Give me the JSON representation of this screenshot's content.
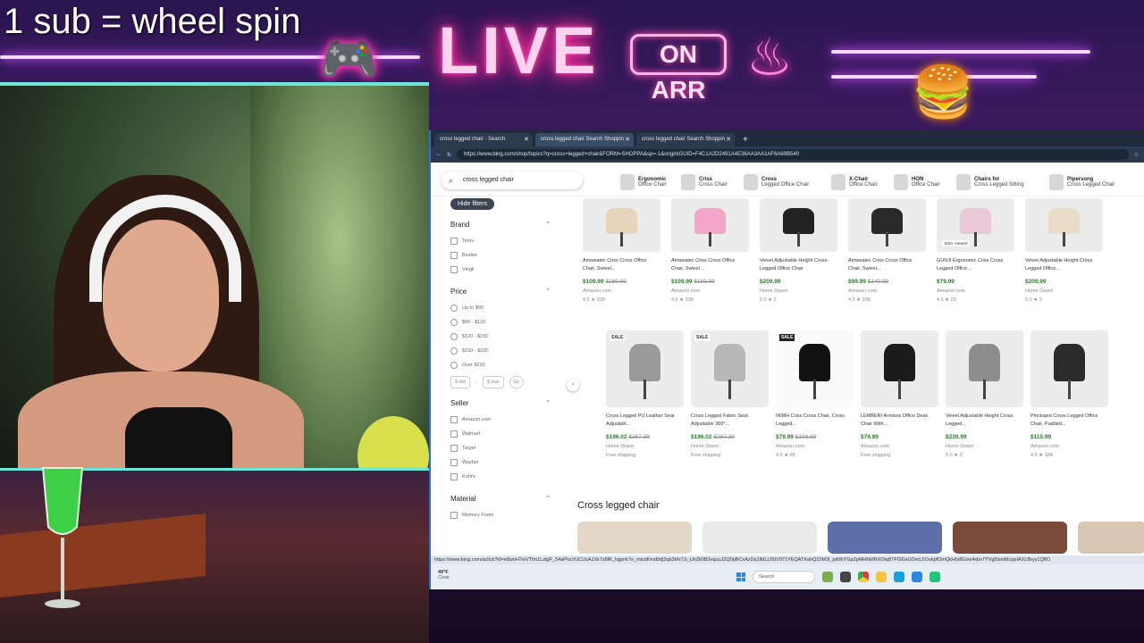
{
  "overlay": {
    "sub_text": "1 sub = wheel spin",
    "live_text": "LIVE",
    "onair_text": "ON ARR"
  },
  "browser": {
    "tabs": [
      {
        "label": "cross legged chair - Search",
        "active": false
      },
      {
        "label": "cross legged chair Search Shoppin",
        "active": true
      },
      {
        "label": "cross legged chair Search Shoppin",
        "active": false
      }
    ],
    "url": "https://www.bing.com/shop/topics?q=cross+legged+chair&FORM=SHOPPA&sp=-1&originIGUID=F4C1A2D2491A4E36AA3AA1AF6A69B540",
    "search_value": "cross legged chair",
    "chips": [
      {
        "top": "Ergonomic",
        "bottom": "Office Chair"
      },
      {
        "top": "Criss",
        "bottom": "Cross Chair"
      },
      {
        "top": "Cross",
        "bottom": "Legged Office Chair"
      },
      {
        "top": "X-Chair",
        "bottom": "Office Chair"
      },
      {
        "top": "HON",
        "bottom": "Office Chair"
      },
      {
        "top": "Chairs for",
        "bottom": "Cross Legged Sitting"
      },
      {
        "top": "Pipersong",
        "bottom": "Cross Legged Chair"
      }
    ],
    "hide_filters": "Hide filters",
    "filters": {
      "brand": {
        "title": "Brand",
        "options": [
          "Temu",
          "Bestier",
          "Vingli"
        ]
      },
      "price": {
        "title": "Price",
        "options": [
          "Up to $90",
          "$90 - $120",
          "$120 - $150",
          "$150 - $220",
          "Over $220"
        ],
        "min": "$ min",
        "max": "$ max",
        "go": "Go"
      },
      "seller": {
        "title": "Seller",
        "options": [
          "Amazon.com",
          "Walmart",
          "Target",
          "Wayfair",
          "Kohl's"
        ]
      },
      "material": {
        "title": "Material",
        "options": [
          "Memory Foam"
        ]
      }
    },
    "row1": [
      {
        "title": "Amweatec Criss Cross Office Chair, Swivel...",
        "price": "$109.99",
        "old": "$169.99",
        "store": "Amazon.com",
        "rating": "4.5 ★ 338"
      },
      {
        "title": "Amweatec Criss Cross Office Chair, Swivel...",
        "price": "$109.99",
        "old": "$169.99",
        "store": "Amazon.com",
        "rating": "4.5 ★ 338"
      },
      {
        "title": "Velvet Adjustable Height Cross-Legged Office Chair",
        "price": "$209.99",
        "old": "",
        "store": "Home Depot",
        "rating": "5.0 ★ 2"
      },
      {
        "title": "Amweatec Criss Cross Office Chair, Swivel...",
        "price": "$99.99",
        "old": "$149.99",
        "store": "Amazon.com",
        "rating": "4.5 ★ 338"
      },
      {
        "title": "GUNJI Ergonomic Criss Cross Legged Office...",
        "price": "$79.99",
        "old": "",
        "store": "Amazon.com",
        "rating": "4.5 ★ 25",
        "badge": "500+ viewed"
      },
      {
        "title": "Velvet Adjustable Height Cross Legged Office...",
        "price": "$209.99",
        "old": "",
        "store": "Home Depot",
        "rating": "5.0 ★ 3"
      }
    ],
    "row2": [
      {
        "title": "Cross Legged PU Leather Seat Adjustabl...",
        "price": "$196.02",
        "old": "$287.39",
        "store": "Home Depot",
        "ship": "Free shipping",
        "sale": "SALE"
      },
      {
        "title": "Cross Legged Fabric Seat Adjustable 360°...",
        "price": "$196.02",
        "old": "$287.39",
        "store": "Home Depot",
        "ship": "Free shipping",
        "sale": "SALE"
      },
      {
        "title": "IWMH Criss Cross Chair, Cross Legged...",
        "price": "$79.99",
        "old": "$109.99",
        "store": "Amazon.com",
        "ship": "4.5 ★ 85",
        "sale": "SALE"
      },
      {
        "title": "LEMBERI Armless Office Desk Chair With...",
        "price": "$79.99",
        "old": "",
        "store": "Amazon.com",
        "ship": "Free shipping",
        "sale": ""
      },
      {
        "title": "Velvet Adjustable Height Cross Legged...",
        "price": "$239.99",
        "old": "",
        "store": "Home Depot",
        "ship": "5.0 ★ 3",
        "sale": ""
      },
      {
        "title": "Pinckspot Cross Legged Office Chair, Padded...",
        "price": "$115.99",
        "old": "",
        "store": "Amazon.com",
        "ship": "4.5 ★ 184",
        "sale": ""
      }
    ],
    "section_title": "Cross legged chair",
    "status_url": "https://www.bing.com/aclick?ld=e8woH7wVThn1LzlgP_54aPhzVUCUzAJXk7z8lR_hgpnk7e_micdKmd0dj2qb3kfv7Ji_UhZk0B3vquuJ2Q0pBCxAzDq1lbILLfSIV971YEQATKahQ22M3l_ptMbYGp2pMHNkfRXOtq8TFf3GxGDmL5OukpfOmQkHIsflGow4xbv7YVg5lsmMcppIAXLBryy1QffO",
    "taskbar": {
      "weather_temp": "49°F",
      "weather_desc": "Clear",
      "search": "Search"
    }
  },
  "colors": {
    "neon_pink": "#ff2b9a",
    "neon_cyan": "#6ce6d8",
    "price_green": "#2b7a2b"
  }
}
